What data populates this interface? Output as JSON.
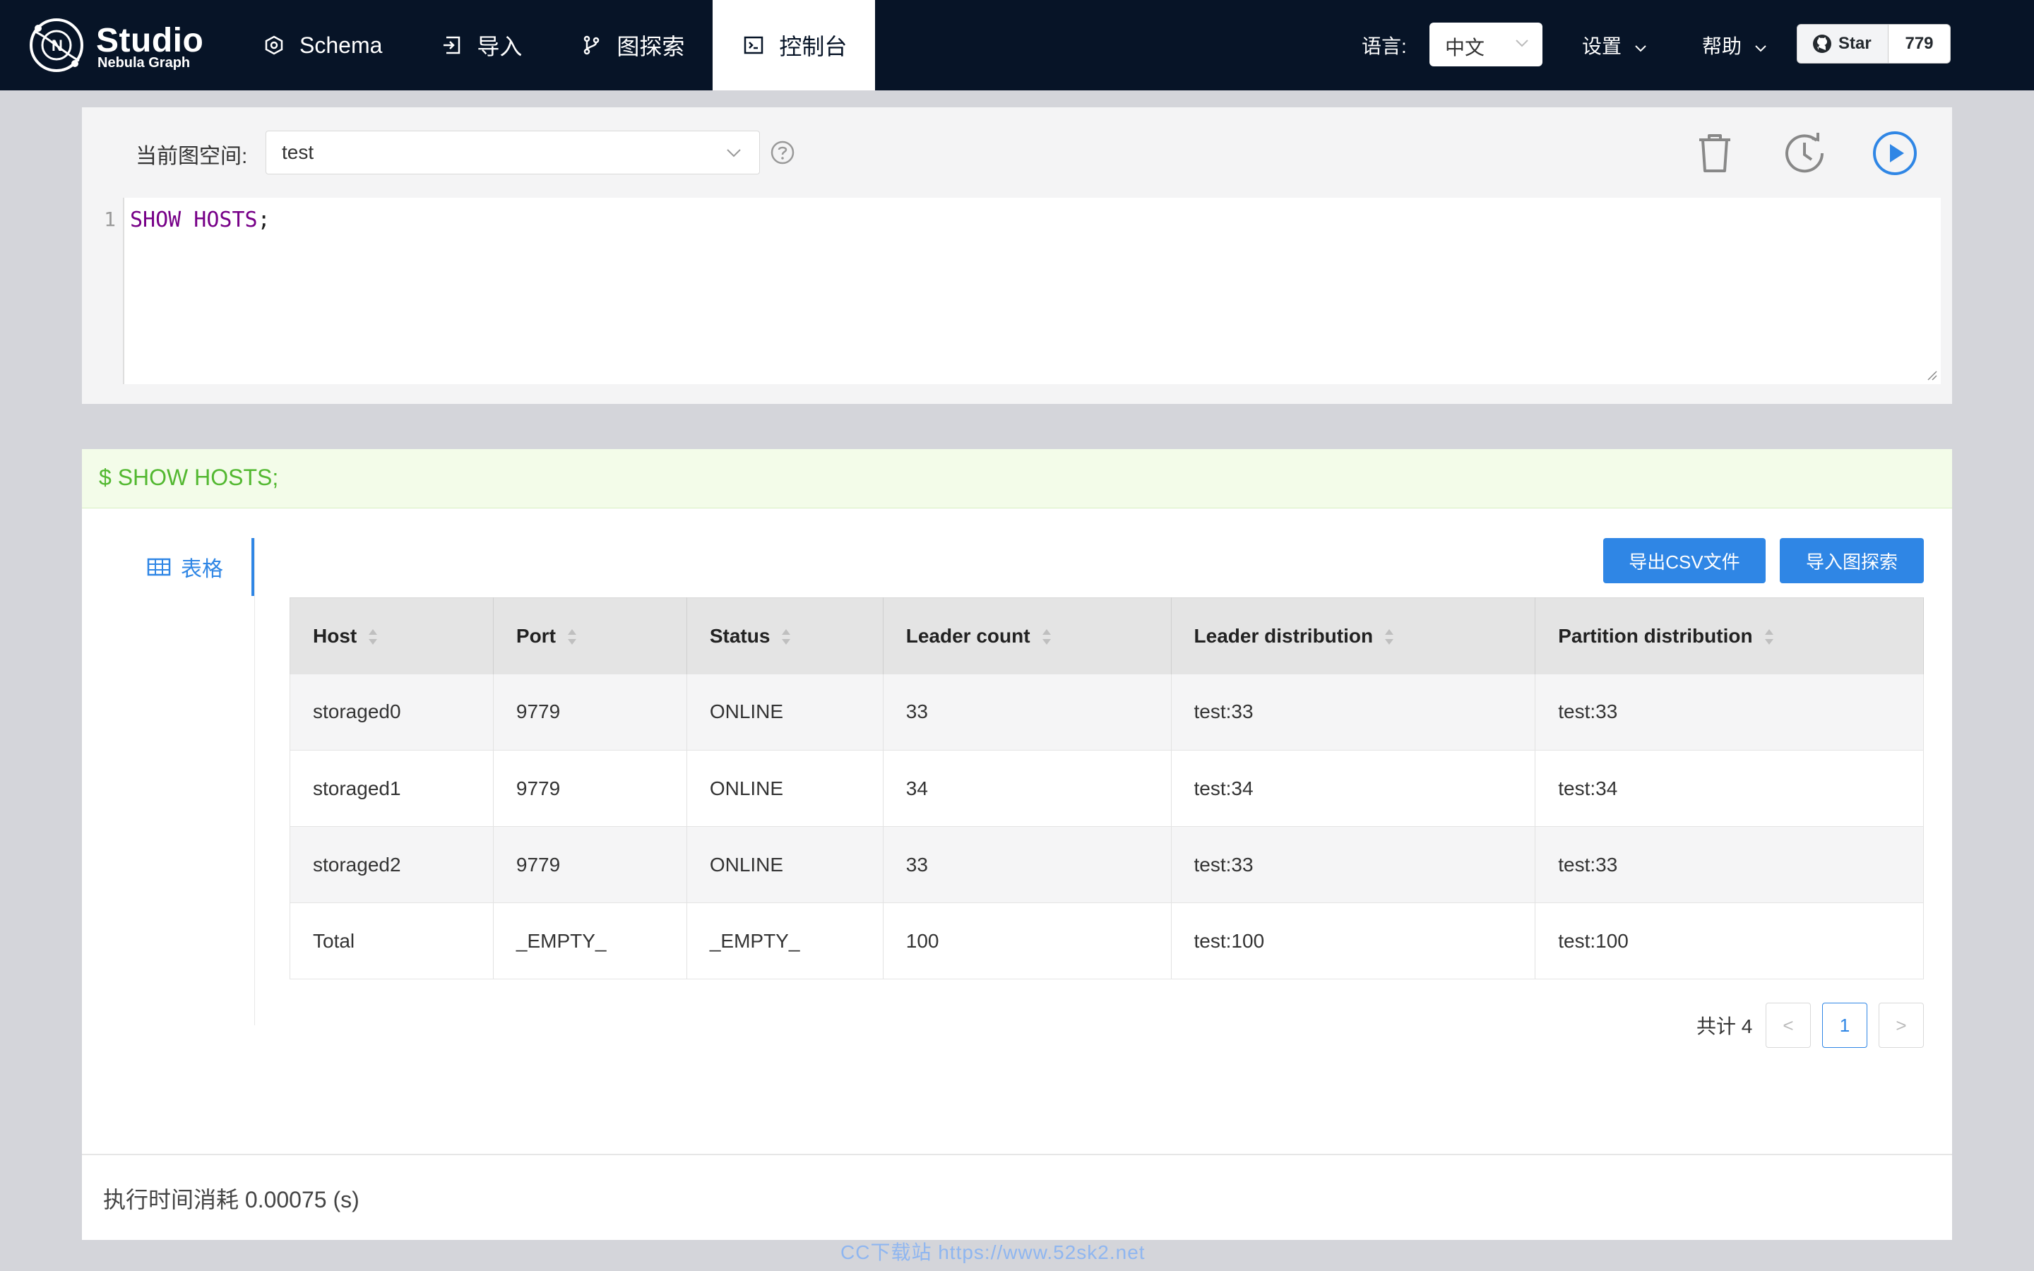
{
  "header": {
    "logo": {
      "title": "Studio",
      "subtitle": "Nebula Graph"
    },
    "nav": [
      {
        "label": "Schema",
        "icon": "schema-icon"
      },
      {
        "label": "导入",
        "icon": "import-icon"
      },
      {
        "label": "图探索",
        "icon": "explore-icon"
      },
      {
        "label": "控制台",
        "icon": "console-icon",
        "active": true
      }
    ],
    "language_label": "语言:",
    "language_value": "中文",
    "settings_label": "设置",
    "help_label": "帮助",
    "github": {
      "star_label": "Star",
      "count": "779"
    }
  },
  "editor": {
    "space_label": "当前图空间:",
    "space_value": "test",
    "line_number": "1",
    "code_keyword": "SHOW HOSTS",
    "code_rest": ";",
    "tools": [
      "delete-icon",
      "history-icon",
      "run-icon"
    ]
  },
  "result": {
    "query": "$ SHOW HOSTS;",
    "tab_label": "表格",
    "export_csv_label": "导出CSV文件",
    "import_explore_label": "导入图探索",
    "columns": [
      "Host",
      "Port",
      "Status",
      "Leader count",
      "Leader distribution",
      "Partition distribution"
    ],
    "rows": [
      [
        "storaged0",
        "9779",
        "ONLINE",
        "33",
        "test:33",
        "test:33"
      ],
      [
        "storaged1",
        "9779",
        "ONLINE",
        "34",
        "test:34",
        "test:34"
      ],
      [
        "storaged2",
        "9779",
        "ONLINE",
        "33",
        "test:33",
        "test:33"
      ],
      [
        "Total",
        "_EMPTY_",
        "_EMPTY_",
        "100",
        "test:100",
        "test:100"
      ]
    ],
    "pagination": {
      "total_label": "共计 4",
      "prev": "<",
      "current": "1",
      "next": ">"
    },
    "exec_time": "执行时间消耗 0.00075 (s)"
  },
  "watermark": "CC下载站 https://www.52sk2.net",
  "colors": {
    "header_bg": "#071427",
    "accent": "#2f86e5",
    "query_green": "#52b830"
  }
}
